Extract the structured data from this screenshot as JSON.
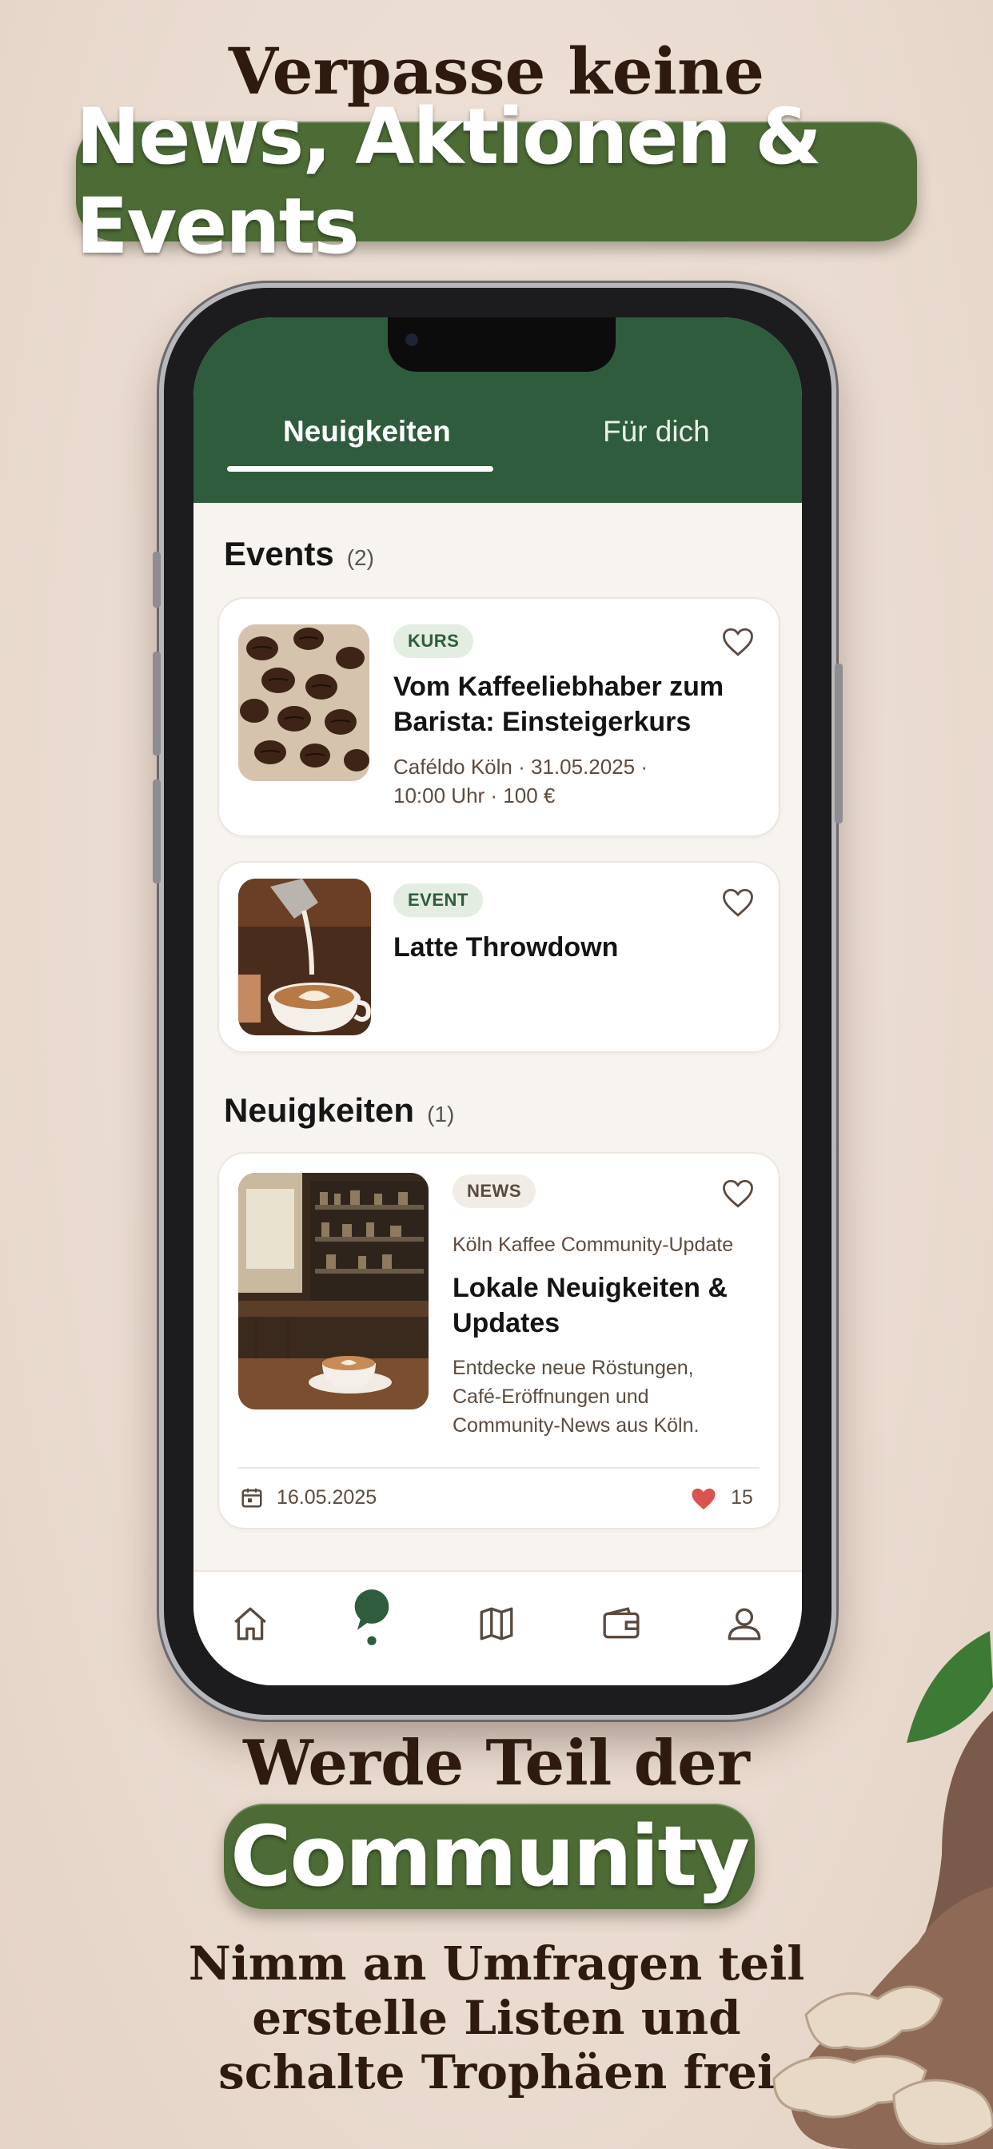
{
  "promo": {
    "headline_top": "Verpasse keine",
    "pill_top": "News, Aktionen & Events",
    "headline_bottom": "Werde Teil der",
    "pill_bottom": "Community",
    "subline_1": "Nimm an Umfragen teil",
    "subline_2": "erstelle Listen und",
    "subline_3": "schalte Trophäen frei"
  },
  "tabs": [
    {
      "label": "Neuigkeiten",
      "active": true
    },
    {
      "label": "Für dich",
      "active": false
    }
  ],
  "events_section": {
    "title": "Events",
    "count": "(2)"
  },
  "events": [
    {
      "badge": "KURS",
      "title_line1": "Vom Kaffeeliebhaber zum",
      "title_line2": "Barista: Einsteigerkurs",
      "meta_line1": "Caféldo Köln · 31.05.2025 ·",
      "meta_line2": "10:00 Uhr · 100 €",
      "favorited": false
    },
    {
      "badge": "EVENT",
      "title_line1": "Latte Throwdown",
      "favorited": false
    }
  ],
  "news_section": {
    "title": "Neuigkeiten",
    "count": "(1)"
  },
  "news": {
    "badge": "NEWS",
    "source": "Köln Kaffee Community-Update",
    "title_line1": "Lokale Neuigkeiten &",
    "title_line2": "Updates",
    "desc_line1": "Entdecke neue Röstungen,",
    "desc_line2": "Café-Eröffnungen und",
    "desc_line3": "Community-News aus Köln.",
    "date": "16.05.2025",
    "likes": "15",
    "liked": true
  },
  "bottom_nav": [
    {
      "icon": "home-icon",
      "active": false
    },
    {
      "icon": "chat-bubble-icon",
      "active": true
    },
    {
      "icon": "map-icon",
      "active": false
    },
    {
      "icon": "wallet-icon",
      "active": false
    },
    {
      "icon": "profile-icon",
      "active": false
    }
  ],
  "colors": {
    "brand_green": "#2f5c3c",
    "pill_green": "#4c6b35",
    "heart_red": "#d9534f",
    "heading_brown": "#2f1a10"
  }
}
